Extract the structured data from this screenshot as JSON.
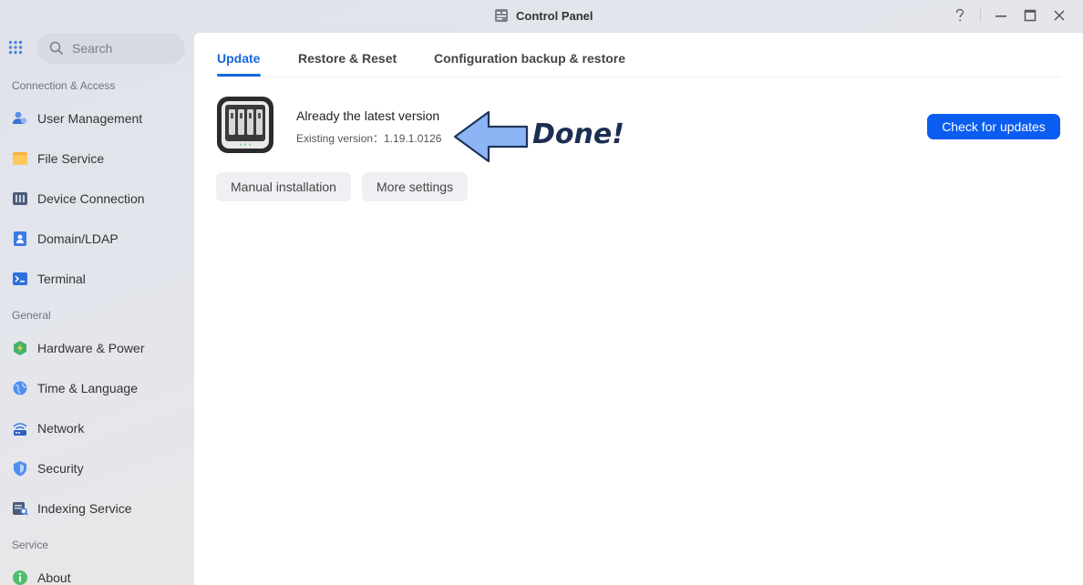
{
  "window": {
    "title": "Control Panel",
    "controls": {
      "help_icon": "question-mark-icon",
      "minimize_icon": "minimize-icon",
      "maximize_icon": "maximize-icon",
      "close_icon": "close-icon"
    }
  },
  "sidebar": {
    "search_placeholder": "Search",
    "sections": [
      {
        "label": "Connection & Access",
        "items": [
          {
            "label": "User Management",
            "icon": "users-icon"
          },
          {
            "label": "File Service",
            "icon": "folder-icon"
          },
          {
            "label": "Device Connection",
            "icon": "device-icon"
          },
          {
            "label": "Domain/LDAP",
            "icon": "domain-icon"
          },
          {
            "label": "Terminal",
            "icon": "terminal-icon"
          }
        ]
      },
      {
        "label": "General",
        "items": [
          {
            "label": "Hardware & Power",
            "icon": "power-icon"
          },
          {
            "label": "Time & Language",
            "icon": "globe-icon"
          },
          {
            "label": "Network",
            "icon": "network-icon"
          },
          {
            "label": "Security",
            "icon": "shield-icon"
          },
          {
            "label": "Indexing Service",
            "icon": "indexing-icon"
          }
        ]
      },
      {
        "label": "Service",
        "items": [
          {
            "label": "About",
            "icon": "info-icon"
          }
        ]
      }
    ]
  },
  "main": {
    "tabs": [
      {
        "label": "Update",
        "active": true
      },
      {
        "label": "Restore & Reset",
        "active": false
      },
      {
        "label": "Configuration backup & restore",
        "active": false
      }
    ],
    "update": {
      "status_title": "Already the latest version",
      "version_label": "Existing version：",
      "version_value": "1.19.1.0126",
      "annotation": "Done!",
      "check_button": "Check for updates",
      "manual_button": "Manual installation",
      "settings_button": "More settings"
    }
  },
  "colors": {
    "accent": "#1668dc",
    "primary_button": "#0b5cf0",
    "annotation_arrow": "#8db4f5"
  }
}
